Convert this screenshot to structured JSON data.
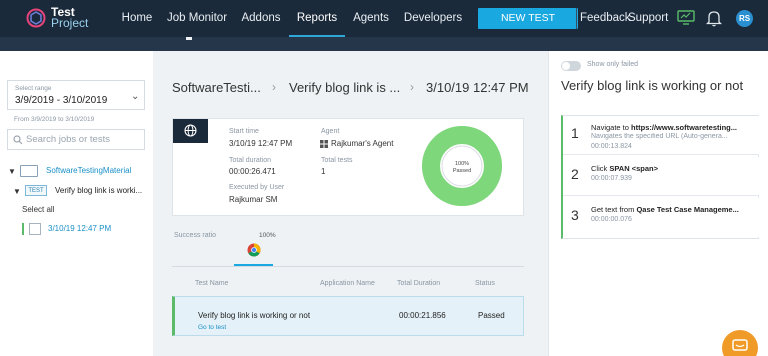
{
  "app": {
    "logo_line1": "Test",
    "logo_line2": "Project",
    "accent": "#1aa8e0",
    "pass_color": "#7ed77a"
  },
  "nav": {
    "items": [
      {
        "label": "Home"
      },
      {
        "label": "Job Monitor"
      },
      {
        "label": "Addons"
      },
      {
        "label": "Reports",
        "active": true
      },
      {
        "label": "Agents"
      },
      {
        "label": "Developers"
      }
    ],
    "new_test": "NEW TEST",
    "feedback": "Feedback",
    "support": "Support",
    "avatar": "RS",
    "icons": [
      "monitor-icon",
      "bell-icon"
    ]
  },
  "sidebar": {
    "range_label": "Select range",
    "range_value": "3/9/2019 - 3/10/2019",
    "range_note": "From 3/9/2019 to 3/10/2019",
    "search_placeholder": "Search jobs or tests",
    "folder_label": "SoftwareTestingMaterial",
    "test_tag": "TEST",
    "test_label": "Verify blog link is worki...",
    "select_all": "Select all",
    "run_label": "3/10/19 12:47 PM"
  },
  "breadcrumb": {
    "project": "SoftwareTesti...",
    "test": "Verify blog link is ...",
    "run": "3/10/19 12:47 PM"
  },
  "summary": {
    "start_label": "Start time",
    "start_value": "3/10/19 12:47 PM",
    "duration_label": "Total duration",
    "duration_value": "00:00:26.471",
    "executed_label": "Executed by User",
    "executed_value": "Rajkumar SM",
    "agent_label": "Agent",
    "agent_value": "Rajkumar's Agent",
    "tests_label": "Total tests",
    "tests_value": "1",
    "donut_percent": "100%",
    "donut_status": "Passed",
    "pass_fraction": 1.0
  },
  "ratio": {
    "label": "Success ratio",
    "value": "100%"
  },
  "table": {
    "headers": [
      "Test Name",
      "Application Name",
      "Total Duration",
      "Status"
    ],
    "rows": [
      {
        "name": "Verify blog link is working or not",
        "link": "Go to test",
        "app": "",
        "duration": "00:00:21.856",
        "status": "Passed"
      }
    ]
  },
  "details": {
    "toggle_label": "Show only failed",
    "title": "Verify blog link is working or not",
    "steps": [
      {
        "num": "1",
        "title_prefix": "Navigate to ",
        "title_bold": "https://www.softwaretesting...",
        "desc": "Navigates the specified URL (Auto-genera...",
        "time": "00:00:13.824"
      },
      {
        "num": "2",
        "title_prefix": "Click ",
        "title_bold": "SPAN <span>",
        "desc": "",
        "time": "00:00:07.939"
      },
      {
        "num": "3",
        "title_prefix": "Get text from ",
        "title_bold": "Qase Test Case Manageme...",
        "desc": "",
        "time": "00:00:00.076"
      }
    ]
  }
}
